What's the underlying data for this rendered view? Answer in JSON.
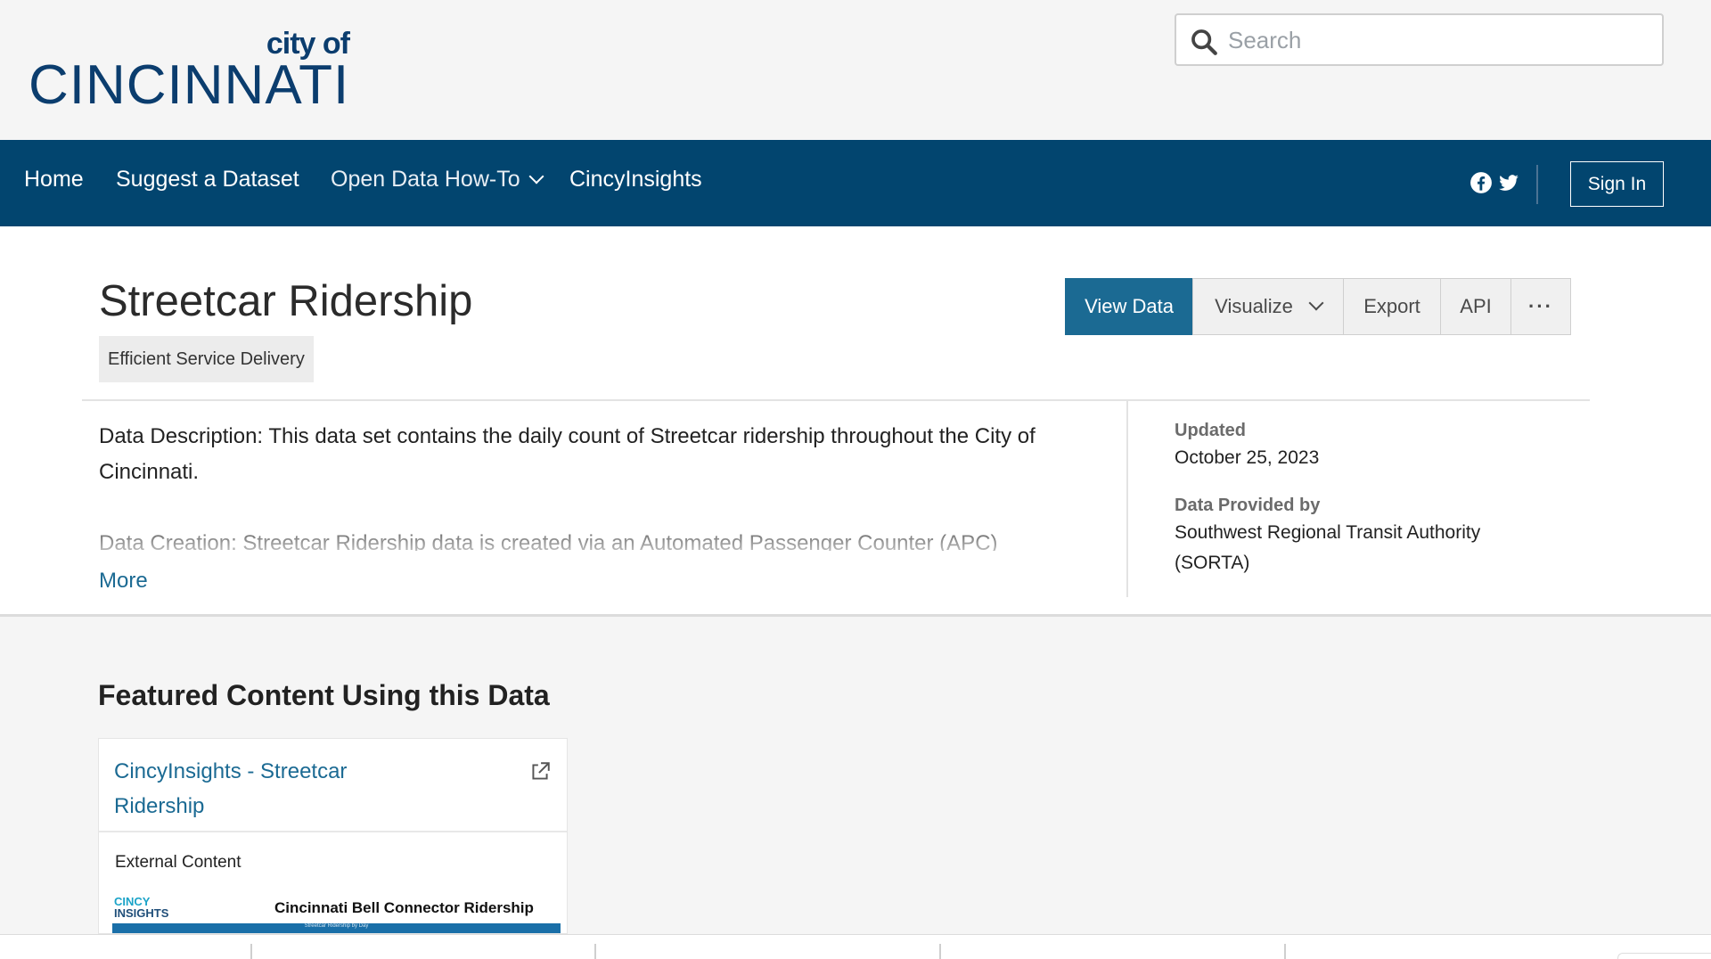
{
  "logo": {
    "line1": "city of",
    "line2": "CINCINNATI"
  },
  "search": {
    "placeholder": "Search",
    "icon": "search-icon"
  },
  "nav": {
    "items": [
      {
        "label": "Home"
      },
      {
        "label": "Suggest a Dataset"
      },
      {
        "label": "Open Data How-To"
      },
      {
        "label": "CincyInsights"
      }
    ],
    "social": [
      "facebook-icon",
      "twitter-icon"
    ],
    "signin_label": "Sign In"
  },
  "dataset": {
    "title": "Streetcar Ridership",
    "category": "Efficient Service Delivery",
    "buttons": {
      "view_data": "View Data",
      "visualize": "Visualize",
      "export": "Export",
      "api": "API",
      "more": "···"
    },
    "description": "Data Description: This data set contains the daily count of Streetcar ridership throughout the City of Cincinnati.",
    "description_more": "Data Creation: Streetcar Ridership data is created via an Automated Passenger Counter (APC)",
    "more_label": "More",
    "updated_label": "Updated",
    "updated_value": "October 25, 2023",
    "provider_label": "Data Provided by",
    "provider_value": "Southwest Regional Transit Authority (SORTA)"
  },
  "featured": {
    "heading": "Featured Content Using this Data",
    "card": {
      "title": "CincyInsights - Streetcar Ridership",
      "type": "External Content",
      "thumb_logo_top": "CINCY",
      "thumb_logo_bottom": "INSIGHTS",
      "thumb_title": "Cincinnati Bell Connector Ridership",
      "thumb_subtitle": "Streetcar Ridership by Day"
    }
  },
  "colors": {
    "nav_bg": "#02456f",
    "primary_button": "#1b6a93",
    "link": "#1b6a93",
    "logo": "#0b3d6e"
  }
}
